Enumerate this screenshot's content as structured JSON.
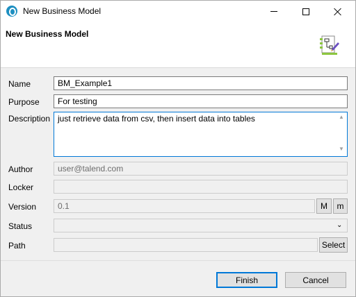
{
  "window": {
    "title": "New Business Model",
    "icon": "talend-app-icon"
  },
  "header": {
    "title": "New Business Model",
    "icon": "business-model-wizard-icon"
  },
  "form": {
    "name_label": "Name",
    "name_value": "BM_Example1",
    "purpose_label": "Purpose",
    "purpose_value": "For testing",
    "description_label": "Description",
    "description_value": "just retrieve data from csv, then insert data into tables",
    "author_label": "Author",
    "author_value": "user@talend.com",
    "locker_label": "Locker",
    "locker_value": "",
    "version_label": "Version",
    "version_value": "0.1",
    "version_major_button": "M",
    "version_minor_button": "m",
    "status_label": "Status",
    "status_value": "",
    "path_label": "Path",
    "path_value": "",
    "path_select_button": "Select"
  },
  "buttons": {
    "finish": "Finish",
    "cancel": "Cancel"
  },
  "colors": {
    "focus_border": "#0078d7",
    "dialog_background": "#f0f0f0"
  }
}
